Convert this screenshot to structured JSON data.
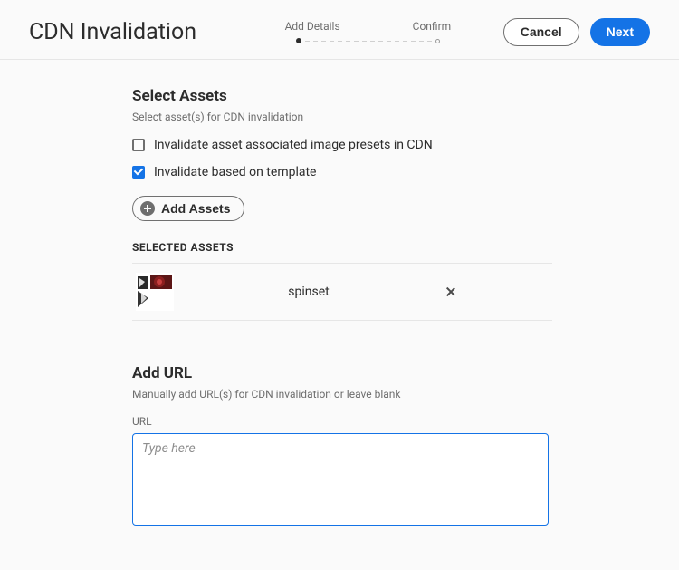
{
  "header": {
    "title": "CDN Invalidation",
    "steps": [
      "Add Details",
      "Confirm"
    ],
    "cancel_label": "Cancel",
    "next_label": "Next"
  },
  "select_assets": {
    "title": "Select Assets",
    "desc": "Select asset(s) for CDN invalidation",
    "checkbox1_label": "Invalidate asset associated image presets in CDN",
    "checkbox1_checked": false,
    "checkbox2_label": "Invalidate based on template",
    "checkbox2_checked": true,
    "add_assets_label": "Add Assets"
  },
  "selected_assets": {
    "title": "SELECTED ASSETS",
    "items": [
      {
        "name": "spinset"
      }
    ]
  },
  "add_url": {
    "title": "Add URL",
    "desc": "Manually add URL(s) for CDN invalidation or leave blank",
    "label": "URL",
    "placeholder": "Type here",
    "value": ""
  }
}
